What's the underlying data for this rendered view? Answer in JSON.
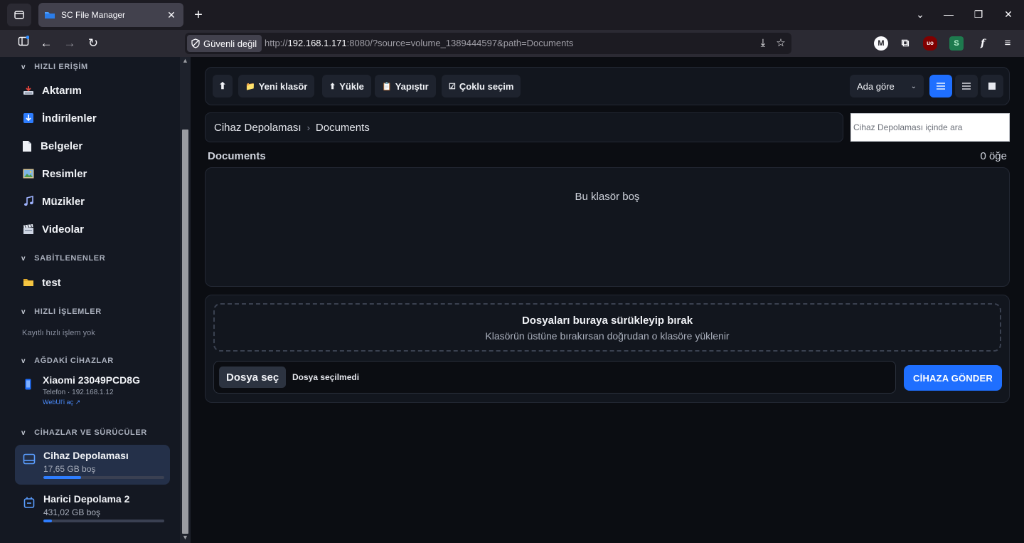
{
  "browser": {
    "tab_title": "SC File Manager",
    "tab_close": "✕",
    "new_tab": "+",
    "security_label": "Güvenli değil",
    "url_prefix": "http://",
    "url_host": "192.168.1.171",
    "url_rest": ":8080/?source=volume_1389444597&path=Documents",
    "extensions": [
      "M",
      "uo",
      "S",
      "f"
    ]
  },
  "sidebar": {
    "sections": {
      "quick_access": "HIZLI ERİŞİM",
      "pinned": "SABİTLENENLER",
      "quick_actions": "HIZLI İŞLEMLER",
      "network_devices": "AĞDAKİ CİHAZLAR",
      "devices_drives": "CİHAZLAR VE SÜRÜCÜLER"
    },
    "quick_items": [
      {
        "label": "Aktarım",
        "icon": "transfer-icon"
      },
      {
        "label": "İndirilenler",
        "icon": "download-icon"
      },
      {
        "label": "Belgeler",
        "icon": "document-icon"
      },
      {
        "label": "Resimler",
        "icon": "picture-icon"
      },
      {
        "label": "Müzikler",
        "icon": "music-icon"
      },
      {
        "label": "Videolar",
        "icon": "clapper-icon"
      }
    ],
    "pinned_items": [
      {
        "label": "test",
        "icon": "folder-icon"
      }
    ],
    "quick_actions_empty": "Kayıtlı hızlı işlem yok",
    "network_device": {
      "name": "Xiaomi 23049PCD8G",
      "sub": "Telefon · 192.168.1.12",
      "link": "WebUI'i aç ↗"
    },
    "drives": [
      {
        "name": "Cihaz Depolaması",
        "free": "17,65 GB boş",
        "used_fraction": 0.31,
        "active": true
      },
      {
        "name": "Harici Depolama 2",
        "free": "431,02 GB boş",
        "used_fraction": 0.07,
        "active": false
      }
    ]
  },
  "toolbar": {
    "up_label": "⬆",
    "new_folder": "Yeni klasör",
    "upload": "Yükle",
    "paste": "Yapıştır",
    "multi_select": "Çoklu seçim",
    "sort_value": "Ada göre"
  },
  "breadcrumb": {
    "root": "Cihaz Depolaması",
    "separator": "›",
    "current": "Documents"
  },
  "search": {
    "placeholder": "Cihaz Depolaması içinde ara"
  },
  "folder": {
    "title": "Documents",
    "count": "0 öğe",
    "empty_message": "Bu klasör boş"
  },
  "upload": {
    "drop_title": "Dosyaları buraya sürükleyip bırak",
    "drop_sub": "Klasörün üstüne bırakırsan doğrudan o klasöre yüklenir",
    "choose_label": "Dosya seç",
    "no_file": "Dosya seçilmedi",
    "send_label": "CİHAZA GÖNDER"
  },
  "colors": {
    "accent": "#1f6fff",
    "background": "#0b0d12",
    "sidebar": "#141822",
    "card": "#12161e"
  }
}
